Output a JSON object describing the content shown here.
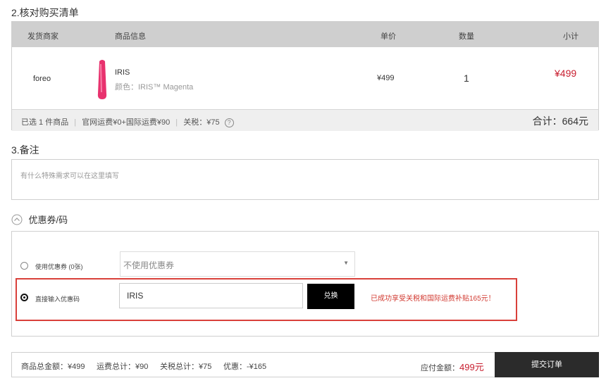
{
  "order_review": {
    "title": "2.核对购买清单",
    "headers": {
      "merchant": "发货商家",
      "product": "商品信息",
      "price": "单价",
      "qty": "数量",
      "subtotal": "小计"
    },
    "item": {
      "merchant": "foreo",
      "name": "IRIS",
      "attr": "颜色：IRIS™ Magenta",
      "price": "¥499",
      "qty": "1",
      "subtotal": "¥499",
      "image_color": "#e8326e"
    },
    "summary": {
      "selected": "已选 1 件商品",
      "shipping": "官网运费¥0+国际运费¥90",
      "tax": "关税：¥75",
      "help": "?",
      "total": "合计：664元"
    }
  },
  "remark": {
    "title": "3.备注",
    "placeholder": "有什么特殊需求可以在这里填写"
  },
  "coupon": {
    "toggle_icon": "chevron-up-icon",
    "title": "优惠券/码",
    "use_coupon_label": "使用优惠券 (0张)",
    "select_value": "不使用优惠券",
    "enter_code_label": "直接输入优惠码",
    "code_value": "IRIS",
    "exchange_label": "兑换",
    "success_message": "已成功享受关税和国际运费补贴165元！",
    "highlight_color": "#d9403a"
  },
  "footer": {
    "goods_total": "商品总金额：¥499",
    "shipping_total": "运费总计：¥90",
    "tax_total": "关税总计：¥75",
    "discount": "优惠：-¥165",
    "payable_label": "应付金额：",
    "payable_value": "499元",
    "submit_label": "提交订单",
    "accent_color": "#d23b32"
  }
}
